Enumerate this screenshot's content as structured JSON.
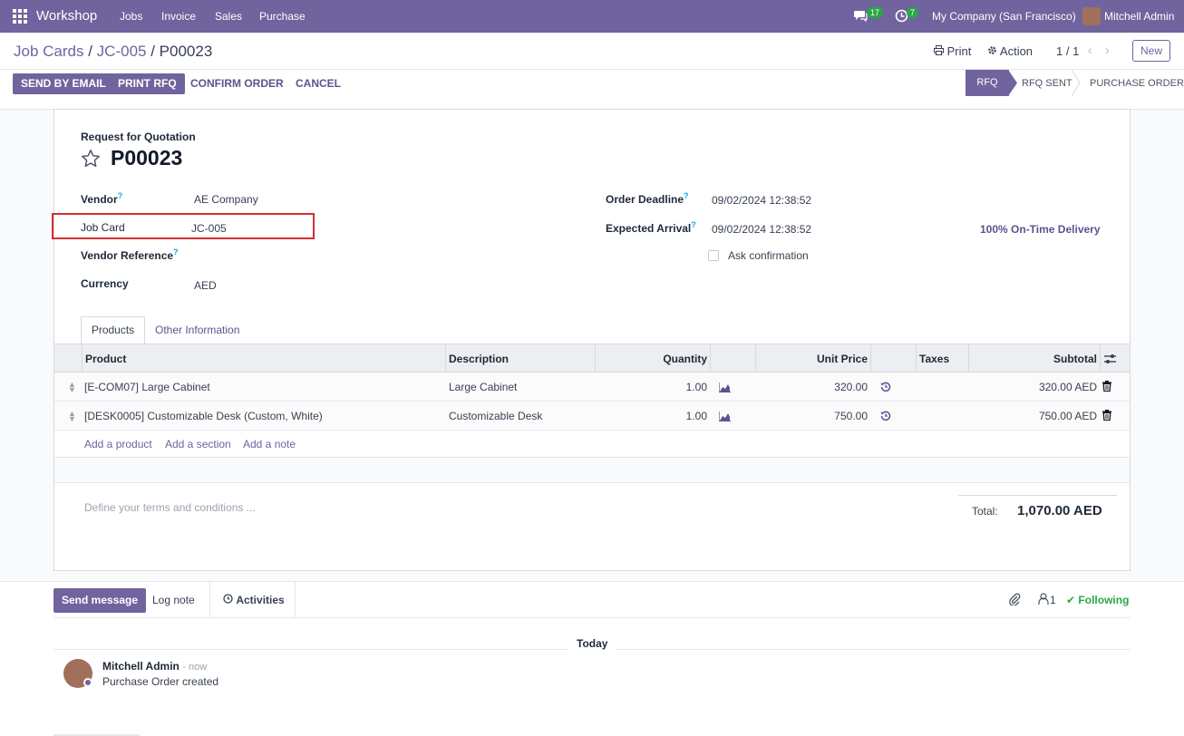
{
  "navbar": {
    "app_name": "Workshop",
    "menu": [
      "Jobs",
      "Invoice",
      "Sales",
      "Purchase"
    ],
    "messages_count": "17",
    "activities_count": "7",
    "company": "My Company (San Francisco)",
    "user": "Mitchell Admin"
  },
  "control_panel": {
    "breadcrumb": [
      "Job Cards",
      "JC-005",
      "P00023"
    ],
    "print_label": "Print",
    "action_label": "Action",
    "pager": "1 / 1",
    "new_label": "New",
    "buttons": [
      "SEND BY EMAIL",
      "PRINT RFQ",
      "CONFIRM ORDER",
      "CANCEL"
    ],
    "statusbar": [
      "RFQ",
      "RFQ SENT",
      "PURCHASE ORDER"
    ]
  },
  "form": {
    "subtitle": "Request for Quotation",
    "title": "P00023",
    "vendor_label": "Vendor",
    "vendor": "AE Company",
    "job_card_label": "Job Card",
    "job_card": "JC-005",
    "vendor_ref_label": "Vendor Reference",
    "currency_label": "Currency",
    "currency": "AED",
    "order_deadline_label": "Order Deadline",
    "order_deadline": "09/02/2024 12:38:52",
    "expected_arrival_label": "Expected Arrival",
    "expected_arrival": "09/02/2024 12:38:52",
    "on_time": "100% On-Time Delivery",
    "ask_confirmation": "Ask confirmation",
    "help_mark": "?"
  },
  "tabs": [
    "Products",
    "Other Information"
  ],
  "table": {
    "headers": [
      "Product",
      "Description",
      "Quantity",
      "Unit Price",
      "Taxes",
      "Subtotal"
    ],
    "rows": [
      {
        "product": "[E-COM07] Large Cabinet",
        "description": "Large Cabinet",
        "quantity": "1.00",
        "unit_price": "320.00",
        "subtotal": "320.00 AED"
      },
      {
        "product": "[DESK0005] Customizable Desk (Custom, White)",
        "description": "Customizable Desk",
        "quantity": "1.00",
        "unit_price": "750.00",
        "subtotal": "750.00 AED"
      }
    ],
    "add_links": [
      "Add a product",
      "Add a section",
      "Add a note"
    ]
  },
  "footer": {
    "terms_placeholder": "Define your terms and conditions ...",
    "total_label": "Total:",
    "total": "1,070.00 AED"
  },
  "chatter": {
    "send_message": "Send message",
    "log_note": "Log note",
    "activities": "Activities",
    "followers": "1",
    "following": "Following",
    "date_sep": "Today",
    "author": "Mitchell Admin",
    "time": "- now",
    "message": "Purchase Order created"
  },
  "colors": {
    "brand": "#71639e",
    "highlight": "#d32f2f",
    "success": "#28a745"
  }
}
